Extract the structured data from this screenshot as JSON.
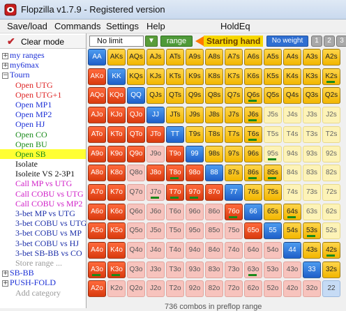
{
  "window": {
    "title": "Flopzilla v1.7.9 - Registered version"
  },
  "menu": [
    "Save/load",
    "Commands",
    "Settings",
    "Help",
    "HoldEq"
  ],
  "sidebar": {
    "clear_mode_label": "Clear mode",
    "tree": [
      {
        "label": "my ranges",
        "type": "folder",
        "expander": "+",
        "color": "blue"
      },
      {
        "label": "my6max",
        "type": "folder",
        "expander": "+",
        "color": "blue"
      },
      {
        "label": "Tourn",
        "type": "folder",
        "expander": "−",
        "color": "blue"
      },
      {
        "label": "Open UTG",
        "type": "item",
        "color": "red"
      },
      {
        "label": "Open UTG+1",
        "type": "item",
        "color": "red"
      },
      {
        "label": "Open MP1",
        "type": "item",
        "color": "blue"
      },
      {
        "label": "Open MP2",
        "type": "item",
        "color": "blue"
      },
      {
        "label": "Open HJ",
        "type": "item",
        "color": "blue"
      },
      {
        "label": "Open CO",
        "type": "item",
        "color": "green"
      },
      {
        "label": "Open BU",
        "type": "item",
        "color": "green"
      },
      {
        "label": "Open SB",
        "type": "item",
        "color": "green",
        "selected": true
      },
      {
        "label": "Isolate",
        "type": "item",
        "color": "black"
      },
      {
        "label": "Isoleite VS 2-3P1",
        "type": "item",
        "color": "black"
      },
      {
        "label": "Call MP vs UTG",
        "type": "item",
        "color": "magenta"
      },
      {
        "label": "Call COBU vs UTG",
        "type": "item",
        "color": "magenta"
      },
      {
        "label": "Call COBU vs MP2",
        "type": "item",
        "color": "magenta"
      },
      {
        "label": "3-bet MP vs UTG",
        "type": "item",
        "color": "navy"
      },
      {
        "label": "3-bet COBU vs UTG",
        "type": "item",
        "color": "navy"
      },
      {
        "label": "3-bet COBU vs MP",
        "type": "item",
        "color": "navy"
      },
      {
        "label": "3-bet COBU vs HJ",
        "type": "item",
        "color": "navy"
      },
      {
        "label": "3-bet SB-BB vs CO",
        "type": "item",
        "color": "navy"
      },
      {
        "label": "Store range ...",
        "type": "item",
        "color": "gray"
      },
      {
        "label": "SB-BB",
        "type": "folder",
        "expander": "+",
        "color": "blue"
      },
      {
        "label": "PUSH-FOLD",
        "type": "folder",
        "expander": "+",
        "color": "blue"
      },
      {
        "label": "Add category",
        "type": "item",
        "color": "gray"
      }
    ]
  },
  "toolbar": {
    "limit_select": "No limit",
    "range_button": "range",
    "starting_hand_label": "Starting hand",
    "no_weight_button": "No weight",
    "number_buttons": [
      "1",
      "2",
      "3"
    ]
  },
  "colors": {
    "selected_red": "#e84a1c",
    "pair_blue": "#2f74d8",
    "suited_yellow": "#f6c21a",
    "offsuit_pink": "#f7c3bd",
    "unselected_cream": "#fdf3b7"
  },
  "grid": {
    "rows": [
      [
        [
          "AA",
          "B"
        ],
        [
          "AKs",
          "Y"
        ],
        [
          "AQs",
          "Y"
        ],
        [
          "AJs",
          "Y"
        ],
        [
          "ATs",
          "Y"
        ],
        [
          "A9s",
          "Y"
        ],
        [
          "A8s",
          "Y"
        ],
        [
          "A7s",
          "Y"
        ],
        [
          "A6s",
          "Y"
        ],
        [
          "A5s",
          "Y"
        ],
        [
          "A4s",
          "Y"
        ],
        [
          "A3s",
          "Y"
        ],
        [
          "A2s",
          "Y"
        ]
      ],
      [
        [
          "AKo",
          "R"
        ],
        [
          "KK",
          "B"
        ],
        [
          "KQs",
          "Y"
        ],
        [
          "KJs",
          "Y"
        ],
        [
          "KTs",
          "Y"
        ],
        [
          "K9s",
          "Y"
        ],
        [
          "K8s",
          "Y"
        ],
        [
          "K7s",
          "Y"
        ],
        [
          "K6s",
          "Y"
        ],
        [
          "K5s",
          "Y"
        ],
        [
          "K4s",
          "Y"
        ],
        [
          "K3s",
          "Y"
        ],
        [
          "K2s",
          "Y"
        ]
      ],
      [
        [
          "AQo",
          "R"
        ],
        [
          "KQo",
          "R"
        ],
        [
          "QQ",
          "B"
        ],
        [
          "QJs",
          "Y"
        ],
        [
          "QTs",
          "Y"
        ],
        [
          "Q9s",
          "Y"
        ],
        [
          "Q8s",
          "Y"
        ],
        [
          "Q7s",
          "Y"
        ],
        [
          "Q6s",
          "Y"
        ],
        [
          "Q5s",
          "Y"
        ],
        [
          "Q4s",
          "Y"
        ],
        [
          "Q3s",
          "Y"
        ],
        [
          "Q2s",
          "Y"
        ]
      ],
      [
        [
          "AJo",
          "R"
        ],
        [
          "KJo",
          "R"
        ],
        [
          "QJo",
          "R"
        ],
        [
          "JJ",
          "B"
        ],
        [
          "JTs",
          "Y"
        ],
        [
          "J9s",
          "Y"
        ],
        [
          "J8s",
          "Y"
        ],
        [
          "J7s",
          "Y"
        ],
        [
          "J6s",
          "Y"
        ],
        [
          "J5s",
          "C"
        ],
        [
          "J4s",
          "C"
        ],
        [
          "J3s",
          "C"
        ],
        [
          "J2s",
          "C"
        ]
      ],
      [
        [
          "ATo",
          "R"
        ],
        [
          "KTo",
          "R"
        ],
        [
          "QTo",
          "R"
        ],
        [
          "JTo",
          "R"
        ],
        [
          "TT",
          "B"
        ],
        [
          "T9s",
          "Y"
        ],
        [
          "T8s",
          "Y"
        ],
        [
          "T7s",
          "Y"
        ],
        [
          "T6s",
          "Y"
        ],
        [
          "T5s",
          "C"
        ],
        [
          "T4s",
          "C"
        ],
        [
          "T3s",
          "C"
        ],
        [
          "T2s",
          "C"
        ]
      ],
      [
        [
          "A9o",
          "R"
        ],
        [
          "K9o",
          "R"
        ],
        [
          "Q9o",
          "R"
        ],
        [
          "J9o",
          "P"
        ],
        [
          "T9o",
          "R"
        ],
        [
          "99",
          "B"
        ],
        [
          "98s",
          "Y"
        ],
        [
          "97s",
          "Y"
        ],
        [
          "96s",
          "Y"
        ],
        [
          "95s",
          "C"
        ],
        [
          "94s",
          "C"
        ],
        [
          "93s",
          "C"
        ],
        [
          "92s",
          "C"
        ]
      ],
      [
        [
          "A8o",
          "R"
        ],
        [
          "K8o",
          "R"
        ],
        [
          "Q8o",
          "P"
        ],
        [
          "J8o",
          "R"
        ],
        [
          "T8o",
          "R"
        ],
        [
          "98o",
          "R"
        ],
        [
          "88",
          "B"
        ],
        [
          "87s",
          "Y"
        ],
        [
          "86s",
          "Y"
        ],
        [
          "85s",
          "Y"
        ],
        [
          "84s",
          "C"
        ],
        [
          "83s",
          "C"
        ],
        [
          "82s",
          "C"
        ]
      ],
      [
        [
          "A7o",
          "R"
        ],
        [
          "K7o",
          "R"
        ],
        [
          "Q7o",
          "P"
        ],
        [
          "J7o",
          "P"
        ],
        [
          "T7o",
          "R"
        ],
        [
          "97o",
          "R"
        ],
        [
          "87o",
          "R"
        ],
        [
          "77",
          "B"
        ],
        [
          "76s",
          "Y"
        ],
        [
          "75s",
          "Y"
        ],
        [
          "74s",
          "C"
        ],
        [
          "73s",
          "C"
        ],
        [
          "72s",
          "C"
        ]
      ],
      [
        [
          "A6o",
          "R"
        ],
        [
          "K6o",
          "R"
        ],
        [
          "Q6o",
          "P"
        ],
        [
          "J6o",
          "P"
        ],
        [
          "T6o",
          "P"
        ],
        [
          "96o",
          "P"
        ],
        [
          "86o",
          "P"
        ],
        [
          "76o",
          "R"
        ],
        [
          "66",
          "B"
        ],
        [
          "65s",
          "Y"
        ],
        [
          "64s",
          "Y"
        ],
        [
          "63s",
          "C"
        ],
        [
          "62s",
          "C"
        ]
      ],
      [
        [
          "A5o",
          "R"
        ],
        [
          "K5o",
          "R"
        ],
        [
          "Q5o",
          "P"
        ],
        [
          "J5o",
          "P"
        ],
        [
          "T5o",
          "P"
        ],
        [
          "95o",
          "P"
        ],
        [
          "85o",
          "P"
        ],
        [
          "75o",
          "P"
        ],
        [
          "65o",
          "R"
        ],
        [
          "55",
          "B"
        ],
        [
          "54s",
          "Y"
        ],
        [
          "53s",
          "Y"
        ],
        [
          "52s",
          "C"
        ]
      ],
      [
        [
          "A4o",
          "R"
        ],
        [
          "K4o",
          "R"
        ],
        [
          "Q4o",
          "P"
        ],
        [
          "J4o",
          "P"
        ],
        [
          "T4o",
          "P"
        ],
        [
          "94o",
          "P"
        ],
        [
          "84o",
          "P"
        ],
        [
          "74o",
          "P"
        ],
        [
          "64o",
          "P"
        ],
        [
          "54o",
          "P"
        ],
        [
          "44",
          "B"
        ],
        [
          "43s",
          "Y"
        ],
        [
          "42s",
          "Y"
        ]
      ],
      [
        [
          "A3o",
          "R"
        ],
        [
          "K3o",
          "R"
        ],
        [
          "Q3o",
          "P"
        ],
        [
          "J3o",
          "P"
        ],
        [
          "T3o",
          "P"
        ],
        [
          "93o",
          "P"
        ],
        [
          "83o",
          "P"
        ],
        [
          "73o",
          "P"
        ],
        [
          "63o",
          "P"
        ],
        [
          "53o",
          "P"
        ],
        [
          "43o",
          "P"
        ],
        [
          "33",
          "B"
        ],
        [
          "32s",
          "Y"
        ]
      ],
      [
        [
          "A2o",
          "R"
        ],
        [
          "K2o",
          "P"
        ],
        [
          "Q2o",
          "P"
        ],
        [
          "J2o",
          "P"
        ],
        [
          "T2o",
          "P"
        ],
        [
          "92o",
          "P"
        ],
        [
          "82o",
          "P"
        ],
        [
          "72o",
          "P"
        ],
        [
          "62o",
          "P"
        ],
        [
          "52o",
          "P"
        ],
        [
          "42o",
          "P"
        ],
        [
          "32o",
          "P"
        ],
        [
          "22",
          "L"
        ]
      ]
    ],
    "weighted_hands": [
      "K2s",
      "A3o",
      "Q6s",
      "J6s",
      "T6s",
      "T8o",
      "95s",
      "85s",
      "T7o",
      "86s",
      "J7o",
      "97o",
      "76o",
      "64s",
      "63o",
      "53s",
      "42s",
      "K3o"
    ]
  },
  "footer": "736 combos in preflop range"
}
